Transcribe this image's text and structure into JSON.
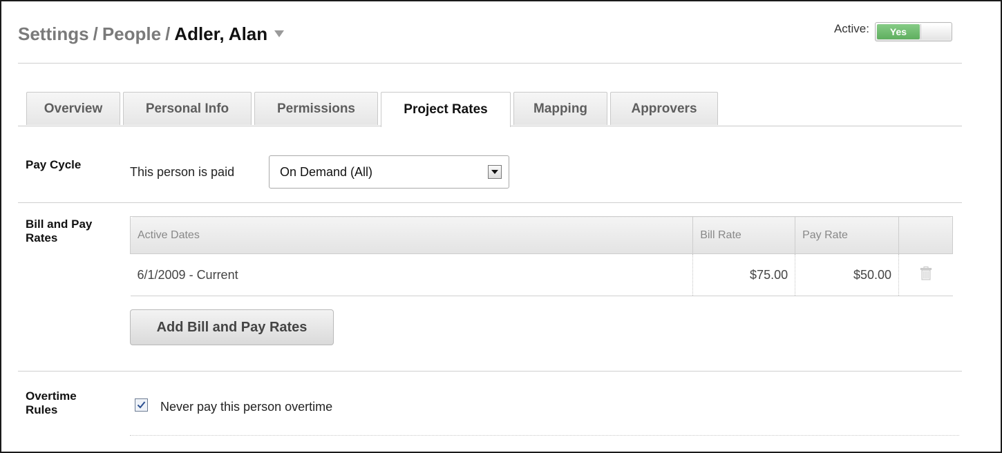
{
  "breadcrumb": {
    "settings": "Settings",
    "people": "People",
    "current": "Adler, Alan",
    "separator": "/"
  },
  "active": {
    "label": "Active:",
    "value": "Yes",
    "on_color": "#6bbb6b"
  },
  "tabs": [
    {
      "label": "Overview"
    },
    {
      "label": "Personal Info"
    },
    {
      "label": "Permissions"
    },
    {
      "label": "Project Rates",
      "active": true
    },
    {
      "label": "Mapping"
    },
    {
      "label": "Approvers"
    }
  ],
  "pay_cycle": {
    "label": "Pay Cycle",
    "prefix": "This person is paid",
    "selected": "On Demand (All)"
  },
  "rates": {
    "label_line1": "Bill and Pay",
    "label_line2": "Rates",
    "columns": [
      "Active Dates",
      "Bill Rate",
      "Pay Rate"
    ],
    "rows": [
      {
        "dates": "6/1/2009 - Current",
        "bill_rate": "$75.00",
        "pay_rate": "$50.00",
        "action_icon": "trash-icon"
      }
    ],
    "add_button": "Add Bill and Pay Rates"
  },
  "overtime": {
    "label_line1": "Overtime",
    "label_line2": "Rules",
    "checkbox_label": "Never pay this person overtime",
    "checked": true
  }
}
